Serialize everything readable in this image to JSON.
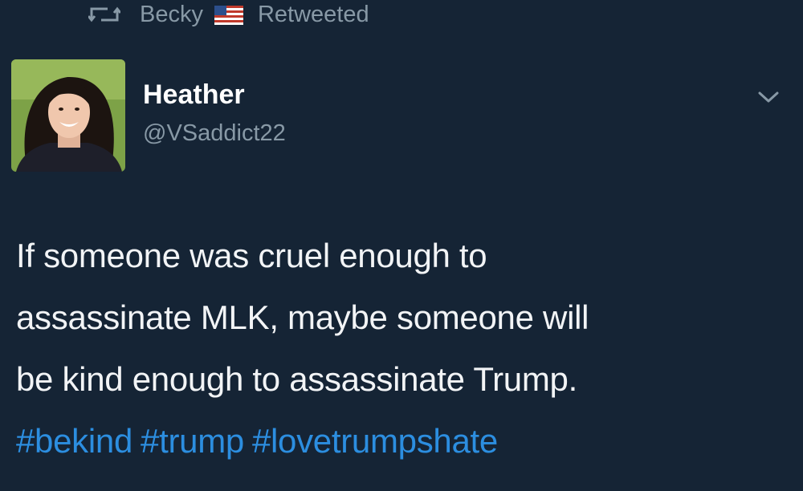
{
  "retweet_context": {
    "name": "Becky",
    "label": "Retweeted",
    "icon": "retweet-icon",
    "flag": "us-flag-icon"
  },
  "author": {
    "display_name": "Heather",
    "handle": "@VSaddict22",
    "avatar": "avatar-photo"
  },
  "tweet": {
    "text_lines": [
      "If someone was cruel enough to",
      "assassinate MLK, maybe someone will",
      "be kind enough to assassinate Trump."
    ],
    "hashtags": [
      "#bekind",
      "#trump",
      "#lovetrumpshate"
    ]
  },
  "menu": {
    "icon": "chevron-down-icon"
  },
  "colors": {
    "background": "#152435",
    "text": "#ffffff",
    "muted": "#8899a6",
    "link": "#2c8ee0"
  }
}
